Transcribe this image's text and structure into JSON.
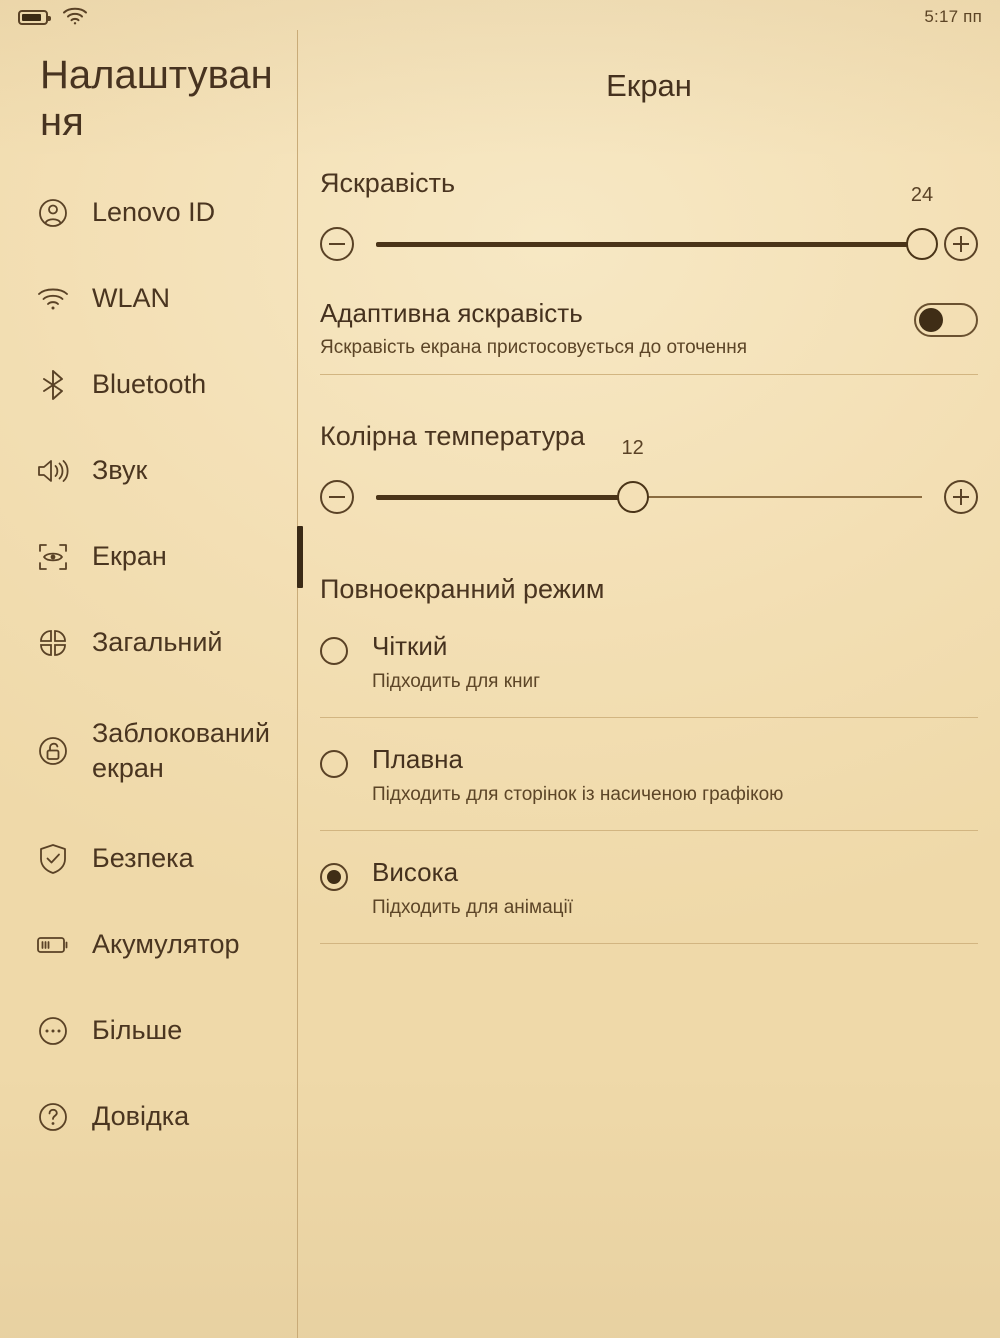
{
  "status_bar": {
    "battery_icon": "battery-icon",
    "wifi_icon": "wifi-icon",
    "time": "5:17 пп"
  },
  "sidebar": {
    "app_title": "Налаштування",
    "items": [
      {
        "label": "Lenovo ID",
        "icon": "account-circle-icon",
        "selected": false
      },
      {
        "label": "WLAN",
        "icon": "wifi-icon",
        "selected": false
      },
      {
        "label": "Bluetooth",
        "icon": "bluetooth-icon",
        "selected": false
      },
      {
        "label": "Звук",
        "icon": "speaker-icon",
        "selected": false
      },
      {
        "label": "Екран",
        "icon": "eye-frame-icon",
        "selected": true
      },
      {
        "label": "Загальний",
        "icon": "clover-grid-icon",
        "selected": false
      },
      {
        "label": "Заблокований екран",
        "icon": "lock-open-icon",
        "selected": false
      },
      {
        "label": "Безпека",
        "icon": "shield-check-icon",
        "selected": false
      },
      {
        "label": "Акумулятор",
        "icon": "battery-icon",
        "selected": false
      },
      {
        "label": "Більше",
        "icon": "more-dots-icon",
        "selected": false
      },
      {
        "label": "Довідка",
        "icon": "help-question-icon",
        "selected": false
      }
    ]
  },
  "main": {
    "title": "Екран",
    "brightness": {
      "heading": "Яскравість",
      "value": "24",
      "percent": 100,
      "minus_icon": "minus-circle-icon",
      "plus_icon": "plus-circle-icon"
    },
    "adaptive": {
      "title": "Адаптивна яскравість",
      "subtitle": "Яскравість екрана пристосовується до оточення",
      "toggle_state": "off"
    },
    "color_temperature": {
      "heading": "Колірна температура",
      "value": "12",
      "percent": 47,
      "minus_icon": "minus-circle-icon",
      "plus_icon": "plus-circle-icon"
    },
    "fullscreen_mode": {
      "heading": "Повноекранний режим",
      "options": [
        {
          "title": "Чіткий",
          "subtitle": "Підходить для книг",
          "selected": false
        },
        {
          "title": "Плавна",
          "subtitle": "Підходить для сторінок із насиченою графікою",
          "selected": false
        },
        {
          "title": "Висока",
          "subtitle": "Підходить для анімації",
          "selected": true
        }
      ]
    }
  },
  "colors": {
    "background": "#f3dfb4",
    "text": "#4a3520",
    "accent": "#3f2d16",
    "divider": "#d2b581"
  }
}
